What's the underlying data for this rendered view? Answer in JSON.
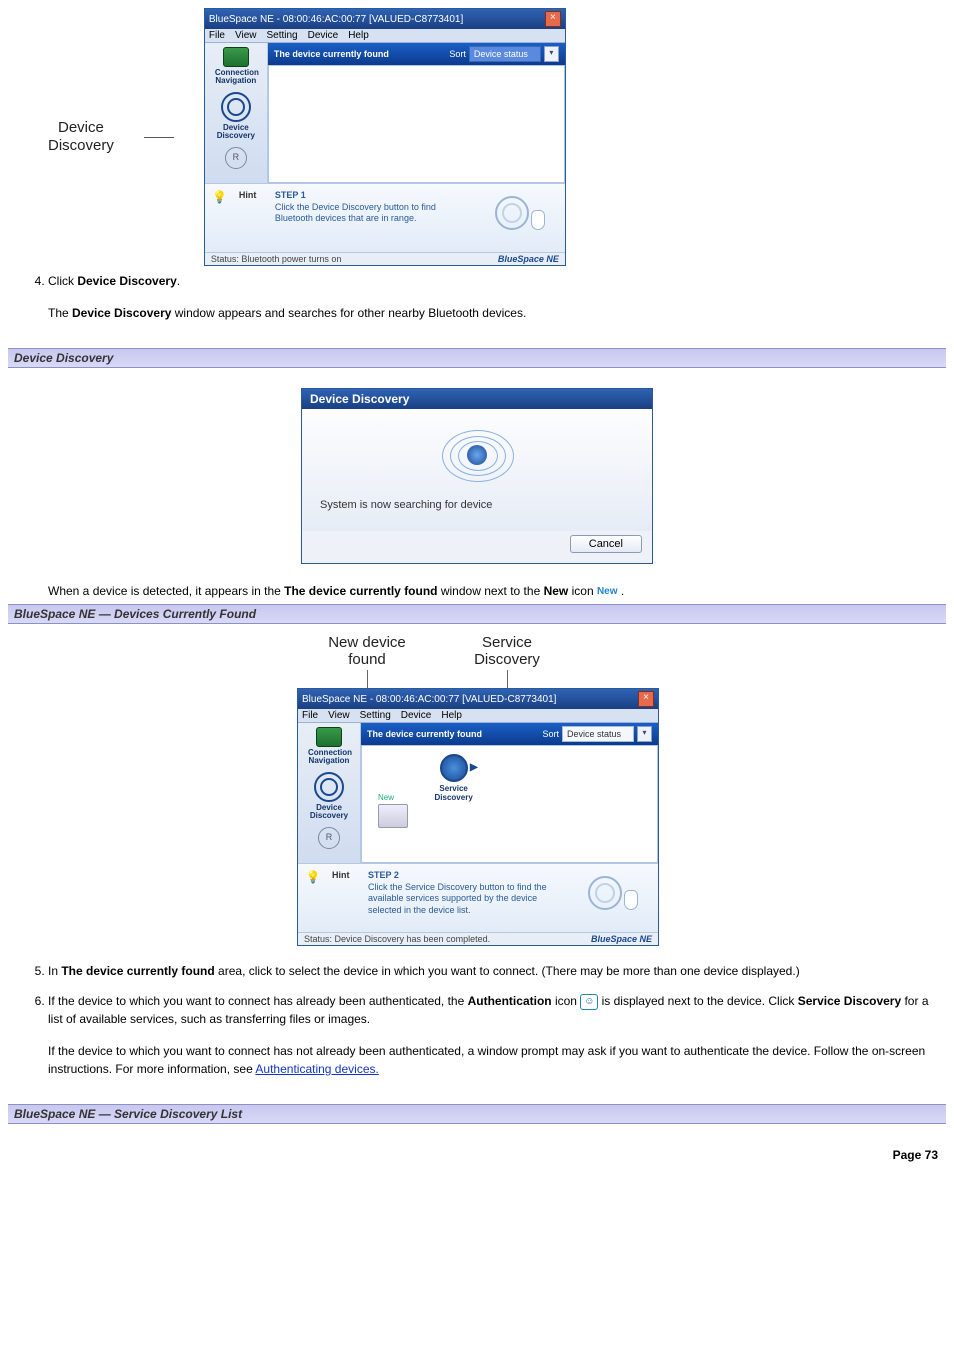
{
  "fig1": {
    "callout": "Device\nDiscovery",
    "title": "BlueSpace NE - 08:00:46:AC:00:77 [VALUED-C8773401]",
    "menus": [
      "File",
      "View",
      "Setting",
      "Device",
      "Help"
    ],
    "list_header": "The device currently found",
    "sort_label": "Sort",
    "sort_sel": "Device status",
    "side": {
      "nav": "Connection\nNavigation",
      "disc": "Device\nDiscovery",
      "r": "R"
    },
    "hint_label": "Hint",
    "hint_step": "STEP 1",
    "hint_text": "Click the Device Discovery button to find Bluetooth devices that are in range.",
    "status_left": "Status: Bluetooth power turns on",
    "status_right": "BlueSpace NE"
  },
  "step4": {
    "a": "Click ",
    "b": "Device Discovery",
    "c": ".",
    "p1": "The ",
    "p2": "Device Discovery",
    "p3": " window appears and searches for other nearby Bluetooth devices."
  },
  "sec1": "Device Discovery",
  "dd": {
    "title": "Device Discovery",
    "msg": "System is now searching for device",
    "cancel": "Cancel"
  },
  "afterdd": {
    "a": "When a device is detected, it appears in the ",
    "b": "The device currently found",
    "c": " window next to the ",
    "d": "New",
    "e": " icon ",
    "new_chip": "New",
    "f": " ."
  },
  "sec2": "BlueSpace NE — Devices Currently Found",
  "fig3": {
    "label_new": "New device\nfound",
    "label_svc": "Service\nDiscovery",
    "title": "BlueSpace NE - 08:00:46:AC:00:77 [VALUED-C8773401]",
    "menus": [
      "File",
      "View",
      "Setting",
      "Device",
      "Help"
    ],
    "list_header": "The device currently found",
    "sort_label": "Sort",
    "sort_sel": "Device status",
    "side": {
      "nav": "Connection\nNavigation",
      "disc": "Device\nDiscovery",
      "r": "R"
    },
    "dev_new": "New",
    "svc_label": "Service\nDiscovery",
    "hint_label": "Hint",
    "hint_step": "STEP 2",
    "hint_text": "Click the Service Discovery button to find the available services supported by the device selected in the device list.",
    "status_left": "Status: Device Discovery has been completed.",
    "status_right": "BlueSpace NE"
  },
  "step5": {
    "a": "In ",
    "b": "The device currently found",
    "c": " area, click to select the device in which you want to connect. (There may be more than one device displayed.)"
  },
  "step6": {
    "a": "If the device to which you want to connect has already been authenticated, the ",
    "b": "Authentication",
    "c": " icon ",
    "auth_chip": "☺",
    "d": " is displayed next to the device. Click ",
    "e": "Service Discovery",
    "f": " for a list of available services, such as transferring files or images.",
    "p2a": "If the device to which you want to connect has not already been authenticated, a window prompt may ask if you want to authenticate the device. Follow the on-screen instructions. For more information, see ",
    "link": "Authenticating devices.",
    "p2b": ""
  },
  "sec3": "BlueSpace NE — Service Discovery List",
  "pagenum": "Page 73"
}
